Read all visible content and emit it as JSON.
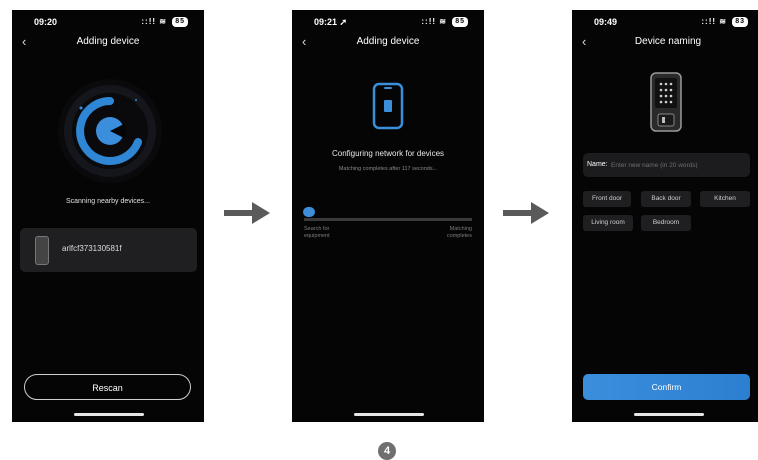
{
  "accent_color": "#3a8edc",
  "screen1": {
    "time": "09:20",
    "signal": "::!!",
    "battery": "85",
    "title": "Adding device",
    "scan_text": "Scanning nearby devices...",
    "device_name": "arlfcf373130581f",
    "rescan_label": "Rescan"
  },
  "screen2": {
    "time": "09:21",
    "location_icon": "➚",
    "signal": "::!!",
    "battery": "85",
    "title": "Adding device",
    "config_title": "Configuring network for devices",
    "config_subtitle": "Matching completes after 117 seconds...",
    "progress": 0.0,
    "left_label_1": "Search for",
    "left_label_2": "equipment",
    "right_label_1": "Matching",
    "right_label_2": "completes"
  },
  "screen3": {
    "time": "09:49",
    "signal": "::!!",
    "battery": "83",
    "title": "Device naming",
    "name_label": "Name:",
    "name_placeholder": "Enter new name (in 20 words)",
    "chips": [
      "Front door",
      "Back door",
      "Kitchen",
      "Living room",
      "Bedroom"
    ],
    "confirm_label": "Confirm"
  },
  "step_number": "4"
}
